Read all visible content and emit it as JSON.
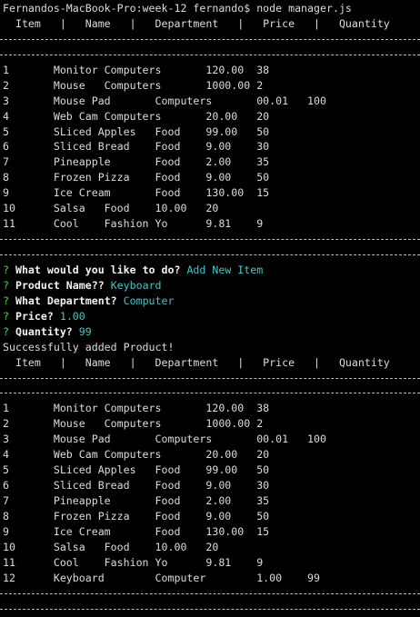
{
  "colors": {
    "background": "#000000",
    "text": "#dcdcdc",
    "prompt_mark": "#4fcf4f",
    "answer": "#3fc7c7"
  },
  "command_line": "Fernandos-MacBook-Pro:week-12 fernando$ node manager.js",
  "table_header": "  Item   |   Name   |   Department   |   Price   |   Quantity",
  "table_before": [
    "1       Monitor Computers       120.00  38",
    "2       Mouse   Computers       1000.00 2",
    "3       Mouse Pad       Computers       00.01   100",
    "4       Web Cam Computers       20.00   20",
    "5       SLiced Apples   Food    99.00   50",
    "6       Sliced Bread    Food    9.00    30",
    "7       Pineapple       Food    2.00    35",
    "8       Frozen Pizza    Food    9.00    50",
    "9       Ice Cream       Food    130.00  15",
    "10      Salsa   Food    10.00   20",
    "11      Cool    Fashion Yo      9.81    9"
  ],
  "prompts": [
    {
      "mark": "?",
      "question": "What would you like to do?",
      "answer": "Add New Item"
    },
    {
      "mark": "?",
      "question": "Product Name??",
      "answer": "Keyboard"
    },
    {
      "mark": "?",
      "question": "What Department?",
      "answer": "Computer"
    },
    {
      "mark": "?",
      "question": "Price?",
      "answer": "1.00"
    },
    {
      "mark": "?",
      "question": "Quantity?",
      "answer": "99"
    }
  ],
  "success_message": "Successfully added Product!",
  "table_after": [
    "1       Monitor Computers       120.00  38",
    "2       Mouse   Computers       1000.00 2",
    "3       Mouse Pad       Computers       00.01   100",
    "4       Web Cam Computers       20.00   20",
    "5       SLiced Apples   Food    99.00   50",
    "6       Sliced Bread    Food    9.00    30",
    "7       Pineapple       Food    2.00    35",
    "8       Frozen Pizza    Food    9.00    50",
    "9       Ice Cream       Food    130.00  15",
    "10      Salsa   Food    10.00   20",
    "11      Cool    Fashion Yo      9.81    9",
    "12      Keyboard        Computer        1.00    99"
  ]
}
